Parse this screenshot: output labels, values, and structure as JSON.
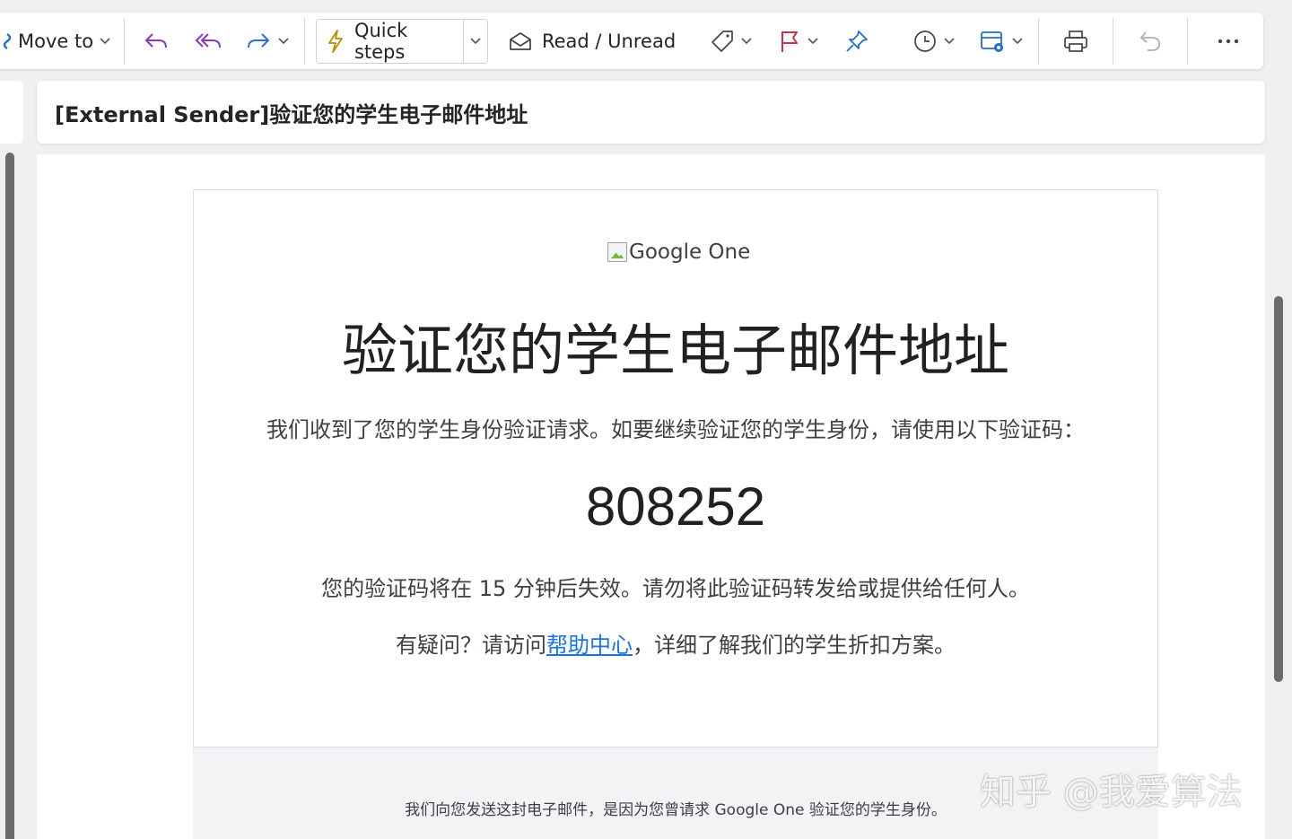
{
  "toolbar": {
    "move_to_label": "Move to",
    "quick_steps_label": "Quick steps",
    "read_unread_label": "Read / Unread"
  },
  "message": {
    "subject": "[External Sender]验证您的学生电子邮件地址",
    "logo_alt": "Google One",
    "headline": "验证您的学生电子邮件地址",
    "intro": "我们收到了您的学生身份验证请求。如要继续验证您的学生身份，请使用以下验证码：",
    "code": "808252",
    "expire_note": "您的验证码将在 15 分钟后失效。请勿将此验证码转发给或提供给任何人。",
    "help_prefix": "有疑问？请访问",
    "help_link": "帮助中心",
    "help_suffix": "，详细了解我们的学生折扣方案。",
    "footer": "我们向您发送这封电子邮件，是因为您曾请求 Google One 验证您的学生身份。"
  },
  "watermark": "知乎 @我爱算法",
  "colors": {
    "reply": "#8a3ab9",
    "forward": "#2f6fd1",
    "quick_steps": "#b39200",
    "flag": "#c4314b",
    "pin": "#1f6fd1",
    "link": "#1a73e8"
  }
}
